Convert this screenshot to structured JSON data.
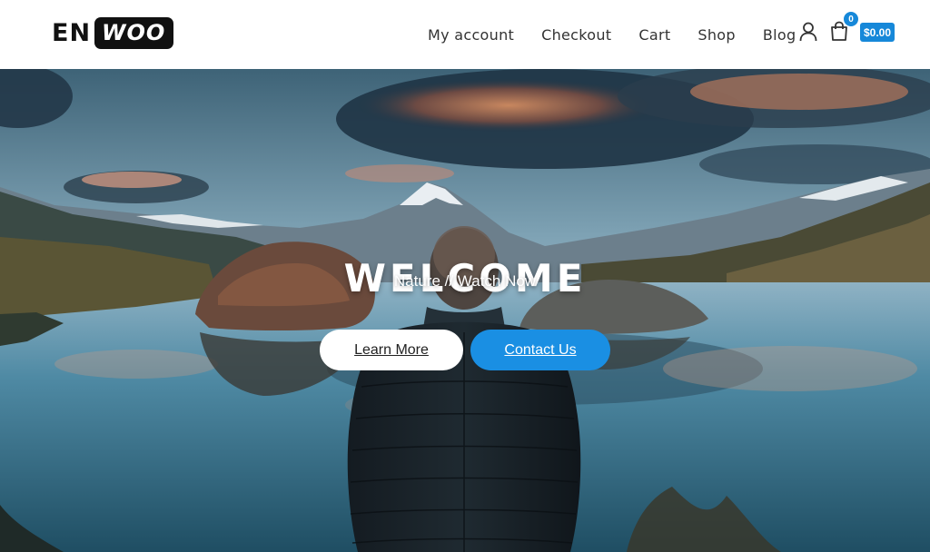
{
  "header": {
    "logo": {
      "part1": "EN",
      "part2": "WOO"
    },
    "nav": [
      {
        "label": "My account"
      },
      {
        "label": "Checkout"
      },
      {
        "label": "Cart"
      },
      {
        "label": "Shop"
      },
      {
        "label": "Blog"
      }
    ],
    "icons": {
      "account": "user-icon",
      "cart": "shopping-bag-icon"
    },
    "cart": {
      "count": "0",
      "total": "$0.00"
    }
  },
  "hero": {
    "title": "WELCOME",
    "subtitle": "Nature // Watch Now",
    "buttons": {
      "primary": "Learn More",
      "secondary": "Contact Us"
    },
    "background": "mountain lake with man in jacket",
    "colors": {
      "accent": "#1a8fe3"
    }
  }
}
